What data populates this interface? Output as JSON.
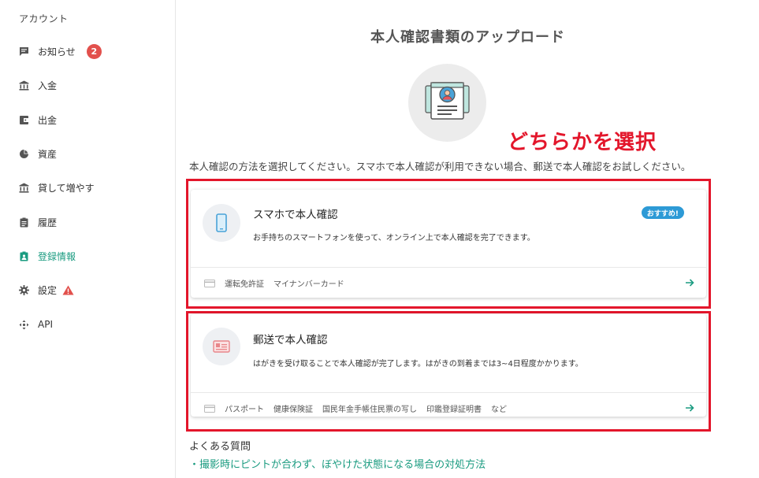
{
  "sidebar": {
    "heading": "アカウント",
    "items": [
      {
        "label": "お知らせ",
        "icon": "message-icon",
        "badge": "2"
      },
      {
        "label": "入金",
        "icon": "bank-icon"
      },
      {
        "label": "出金",
        "icon": "wallet-icon"
      },
      {
        "label": "資産",
        "icon": "pie-chart-icon"
      },
      {
        "label": "貸して増やす",
        "icon": "bank-icon"
      },
      {
        "label": "履歴",
        "icon": "clipboard-icon"
      },
      {
        "label": "登録情報",
        "icon": "id-badge-icon",
        "active": true
      },
      {
        "label": "設定",
        "icon": "gear-icon",
        "warning": true
      },
      {
        "label": "API",
        "icon": "api-icon"
      }
    ]
  },
  "main": {
    "title": "本人確認書類のアップロード",
    "annotation": "どちらかを選択",
    "instructions": "本人確認の方法を選択してください。スマホで本人確認が利用できない場合、郵送で本人確認をお試しください。",
    "options": [
      {
        "title": "スマホで本人確認",
        "badge": "おすすめ!",
        "description": "お手持ちのスマートフォンを使って、オンライン上で本人確認を完了できます。",
        "documents": [
          "運転免許証",
          "マイナンバーカード"
        ]
      },
      {
        "title": "郵送で本人確認",
        "description": "はがきを受け取ることで本人確認が完了します。はがきの到着までは3~4日程度かかります。",
        "documents": [
          "パスポート",
          "健康保険証",
          "国民年金手帳住民票の写し",
          "印鑑登録証明書",
          "など"
        ]
      }
    ],
    "faq": {
      "heading": "よくある質問",
      "link": "・撮影時にピントが合わず、ぼやけた状態になる場合の対処方法"
    }
  },
  "colors": {
    "accent": "#1a9b80",
    "badge": "#e2504c",
    "annotation": "#e3162b",
    "recommend": "#2d9ad6"
  }
}
